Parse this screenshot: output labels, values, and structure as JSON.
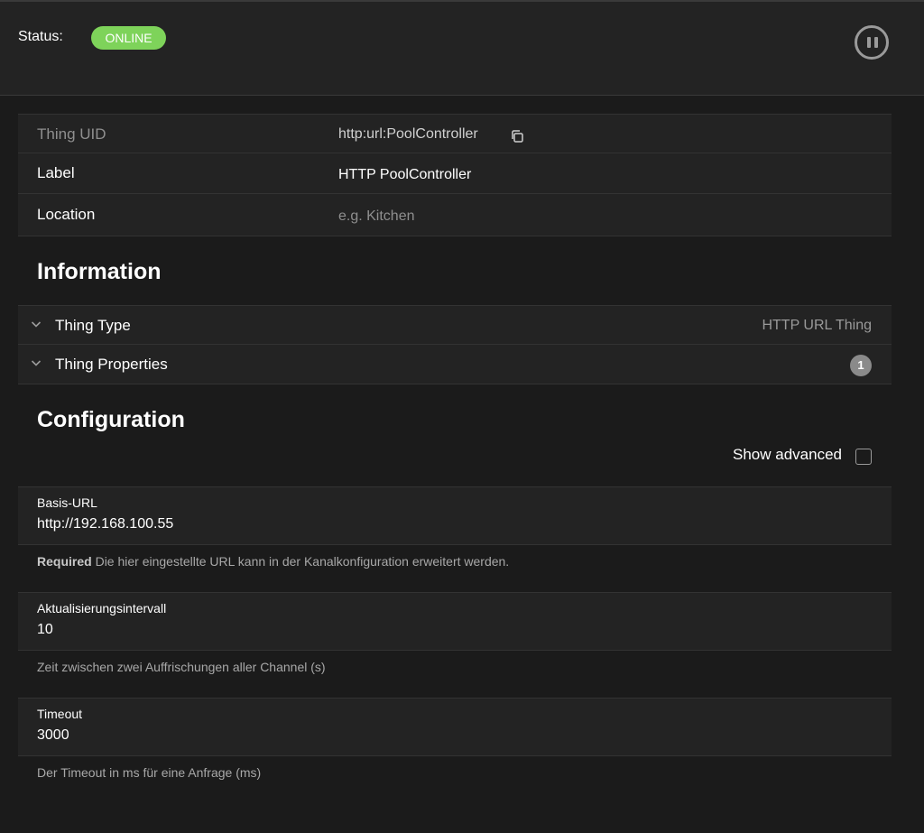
{
  "status": {
    "label": "Status:",
    "badge": "ONLINE",
    "badge_color": "#7ed35a",
    "pause_icon": "pause-circle-icon"
  },
  "props": [
    {
      "key": "Thing UID",
      "value": "http:url:PoolController",
      "copy_icon": "copy-icon"
    },
    {
      "key": "Label",
      "value": "HTTP PoolController"
    },
    {
      "key": "Location",
      "placeholder": "e.g. Kitchen"
    }
  ],
  "information": {
    "title": "Information",
    "items": [
      {
        "label": "Thing Type",
        "value": "HTTP URL Thing"
      },
      {
        "label": "Thing Properties",
        "count": "1"
      }
    ]
  },
  "configuration": {
    "title": "Configuration",
    "show_advanced": "Show advanced",
    "fields": [
      {
        "label": "Basis-URL",
        "value": "http://192.168.100.55",
        "required": "Required",
        "hint": "Die hier eingestellte URL kann in der Kanalkonfiguration erweitert werden."
      },
      {
        "label": "Aktualisierungsintervall",
        "value": "10",
        "hint": "Zeit zwischen zwei Auffrischungen aller Channel (s)"
      },
      {
        "label": "Timeout",
        "value": "3000",
        "hint": "Der Timeout in ms für eine Anfrage (ms)"
      }
    ]
  }
}
